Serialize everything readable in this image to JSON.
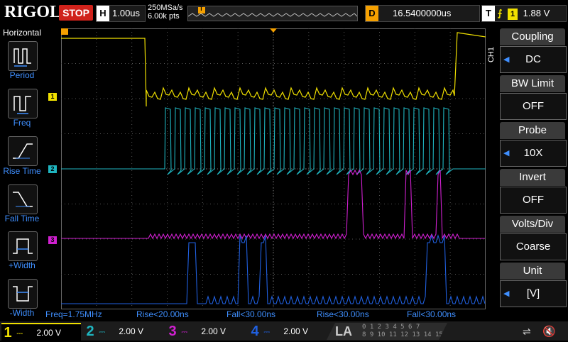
{
  "header": {
    "logo": "RIGOL",
    "run_state": "STOP",
    "horizontal": {
      "label": "H",
      "timebase": "1.00us"
    },
    "sample_rate": "250MSa/s",
    "memory_depth": "6.00k pts",
    "trigger_marker": "T",
    "delay": {
      "label": "D",
      "value": "16.5400000us"
    },
    "trigger": {
      "label": "T",
      "edge_icon": "rising-edge-icon",
      "source": "1",
      "level": "1.88 V"
    }
  },
  "left_menu": {
    "title": "Horizontal",
    "items": [
      {
        "label": "Period",
        "icon": "period-measure-icon"
      },
      {
        "label": "Freq",
        "icon": "frequency-measure-icon"
      },
      {
        "label": "Rise Time",
        "icon": "rise-time-icon"
      },
      {
        "label": "Fall Time",
        "icon": "fall-time-icon"
      },
      {
        "label": "+Width",
        "icon": "positive-width-icon"
      },
      {
        "label": "-Width",
        "icon": "negative-width-icon"
      }
    ]
  },
  "channel_markers": [
    "1",
    "2",
    "3"
  ],
  "right_menu": {
    "channel_tag": "CH1",
    "items": [
      {
        "label": "Coupling",
        "value": "DC",
        "has_arrow": true
      },
      {
        "label": "BW Limit",
        "value": "OFF",
        "has_arrow": false
      },
      {
        "label": "Probe",
        "value": "10X",
        "has_arrow": true
      },
      {
        "label": "Invert",
        "value": "OFF",
        "has_arrow": false
      },
      {
        "label": "Volts/Div",
        "value": "Coarse",
        "has_arrow": false
      },
      {
        "label": "Unit",
        "value": "[V]",
        "has_arrow": true
      }
    ]
  },
  "measurements": {
    "freq": "Freq=1.75MHz",
    "rise1": "Rise<20.00ns",
    "fall1": "Fall<30.00ns",
    "rise2": "Rise<30.00ns",
    "fall2": "Fall<30.00ns"
  },
  "channels": [
    {
      "num": "1",
      "scale": "2.00 V",
      "color": "#f0e000"
    },
    {
      "num": "2",
      "scale": "2.00 V",
      "color": "#1fb5c0"
    },
    {
      "num": "3",
      "scale": "2.00 V",
      "color": "#d020d0"
    },
    {
      "num": "4",
      "scale": "2.00 V",
      "color": "#2060e0"
    }
  ],
  "la": {
    "label": "LA",
    "digits_top": "0 1 2 3  4 5 6 7",
    "digits_bottom": "8 9 10 11  12 13 14 15"
  },
  "status_icons": [
    "usb-icon",
    "speaker-muted-icon"
  ],
  "colors": {
    "accent": "#3f8fff",
    "stop": "#d0221b",
    "delay": "#f5a000"
  }
}
